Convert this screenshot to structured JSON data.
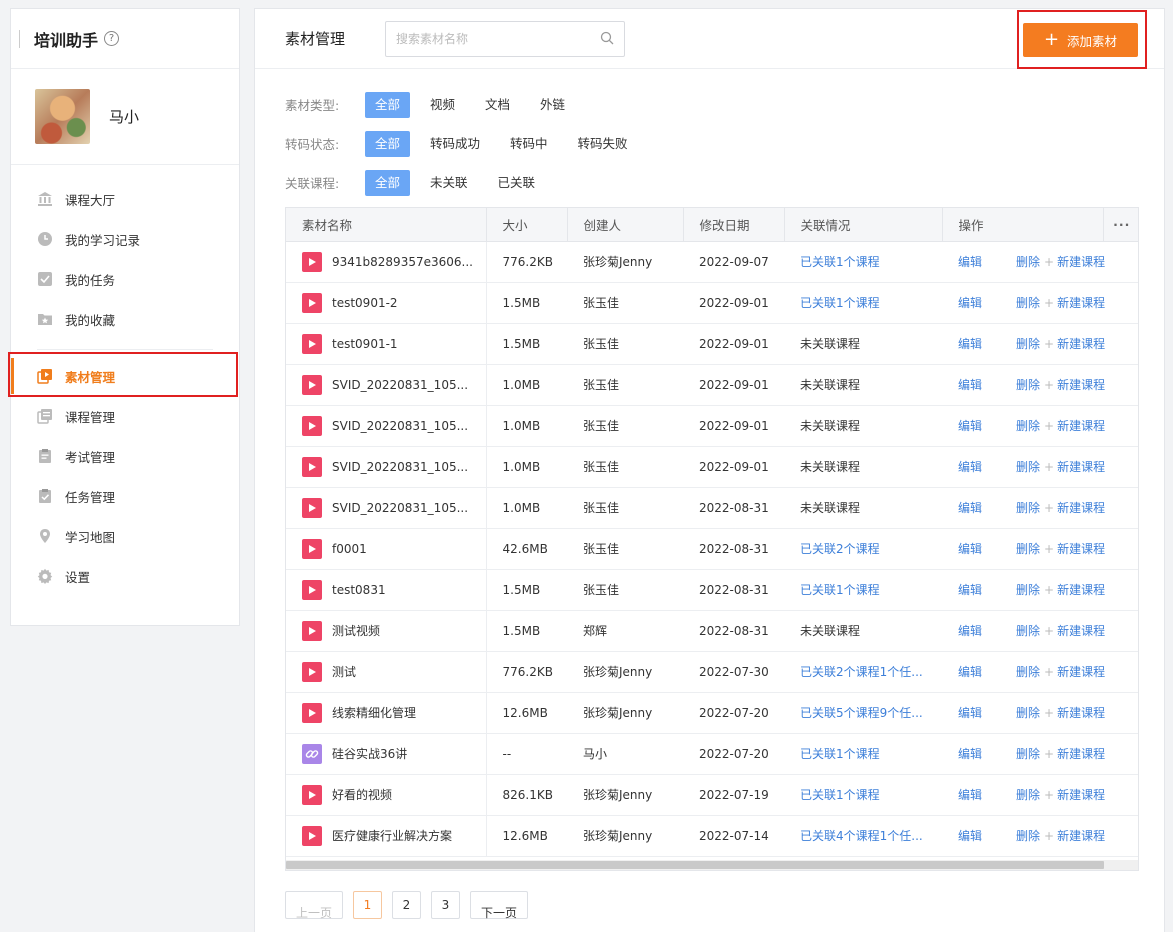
{
  "sidebar": {
    "title": "培训助手",
    "help_icon": "?",
    "user_name": "马小",
    "items": [
      {
        "label": "课程大厅",
        "icon": "bank-icon"
      },
      {
        "label": "我的学习记录",
        "icon": "clock-icon"
      },
      {
        "label": "我的任务",
        "icon": "check-square-icon"
      },
      {
        "label": "我的收藏",
        "icon": "star-folder-icon"
      },
      {
        "label": "素材管理",
        "icon": "media-icon",
        "active": true
      },
      {
        "label": "课程管理",
        "icon": "course-list-icon"
      },
      {
        "label": "考试管理",
        "icon": "exam-clipboard-icon"
      },
      {
        "label": "任务管理",
        "icon": "task-clipboard-icon"
      },
      {
        "label": "学习地图",
        "icon": "map-pin-icon"
      },
      {
        "label": "设置",
        "icon": "gear-icon"
      }
    ]
  },
  "header": {
    "title": "素材管理",
    "search_placeholder": "搜索素材名称",
    "add_button": "添加素材"
  },
  "filters": [
    {
      "label": "素材类型:",
      "options": [
        "全部",
        "视频",
        "文档",
        "外链"
      ],
      "selected": 0
    },
    {
      "label": "转码状态:",
      "options": [
        "全部",
        "转码成功",
        "转码中",
        "转码失败"
      ],
      "selected": 0
    },
    {
      "label": "关联课程:",
      "options": [
        "全部",
        "未关联",
        "已关联"
      ],
      "selected": 0
    }
  ],
  "table": {
    "columns": [
      "素材名称",
      "大小",
      "创建人",
      "修改日期",
      "关联情况",
      "操作",
      "···"
    ],
    "actions": {
      "edit": "编辑",
      "delete": "删除",
      "new_course": "新建课程"
    },
    "rows": [
      {
        "type": "video",
        "name": "9341b8289357e3606...",
        "size": "776.2KB",
        "creator": "张珍菊Jenny",
        "date": "2022-09-07",
        "relation": "已关联1个课程",
        "linked": true
      },
      {
        "type": "video",
        "name": "test0901-2",
        "size": "1.5MB",
        "creator": "张玉佳",
        "date": "2022-09-01",
        "relation": "已关联1个课程",
        "linked": true
      },
      {
        "type": "video",
        "name": "test0901-1",
        "size": "1.5MB",
        "creator": "张玉佳",
        "date": "2022-09-01",
        "relation": "未关联课程",
        "linked": false
      },
      {
        "type": "video",
        "name": "SVID_20220831_105...",
        "size": "1.0MB",
        "creator": "张玉佳",
        "date": "2022-09-01",
        "relation": "未关联课程",
        "linked": false
      },
      {
        "type": "video",
        "name": "SVID_20220831_105...",
        "size": "1.0MB",
        "creator": "张玉佳",
        "date": "2022-09-01",
        "relation": "未关联课程",
        "linked": false
      },
      {
        "type": "video",
        "name": "SVID_20220831_105...",
        "size": "1.0MB",
        "creator": "张玉佳",
        "date": "2022-09-01",
        "relation": "未关联课程",
        "linked": false
      },
      {
        "type": "video",
        "name": "SVID_20220831_105...",
        "size": "1.0MB",
        "creator": "张玉佳",
        "date": "2022-08-31",
        "relation": "未关联课程",
        "linked": false
      },
      {
        "type": "video",
        "name": "f0001",
        "size": "42.6MB",
        "creator": "张玉佳",
        "date": "2022-08-31",
        "relation": "已关联2个课程",
        "linked": true
      },
      {
        "type": "video",
        "name": "test0831",
        "size": "1.5MB",
        "creator": "张玉佳",
        "date": "2022-08-31",
        "relation": "已关联1个课程",
        "linked": true
      },
      {
        "type": "video",
        "name": "测试视频",
        "size": "1.5MB",
        "creator": "郑辉",
        "date": "2022-08-31",
        "relation": "未关联课程",
        "linked": false
      },
      {
        "type": "video",
        "name": "测试",
        "size": "776.2KB",
        "creator": "张珍菊Jenny",
        "date": "2022-07-30",
        "relation": "已关联2个课程1个任...",
        "linked": true
      },
      {
        "type": "video",
        "name": "线索精细化管理",
        "size": "12.6MB",
        "creator": "张珍菊Jenny",
        "date": "2022-07-20",
        "relation": "已关联5个课程9个任...",
        "linked": true
      },
      {
        "type": "link",
        "name": "硅谷实战36讲",
        "size": "--",
        "creator": "马小",
        "date": "2022-07-20",
        "relation": "已关联1个课程",
        "linked": true
      },
      {
        "type": "video",
        "name": "好看的视频",
        "size": "826.1KB",
        "creator": "张珍菊Jenny",
        "date": "2022-07-19",
        "relation": "已关联1个课程",
        "linked": true
      },
      {
        "type": "video",
        "name": "医疗健康行业解决方案",
        "size": "12.6MB",
        "creator": "张珍菊Jenny",
        "date": "2022-07-14",
        "relation": "已关联4个课程1个任...",
        "linked": true
      }
    ]
  },
  "pagination": {
    "prev": "上一页",
    "next": "下一页",
    "pages": [
      "1",
      "2",
      "3"
    ],
    "current": "1"
  },
  "colors": {
    "accent": "#f47c20",
    "chip_selected": "#6aa6f5",
    "link": "#3d7fd9",
    "highlight_box": "#e02020",
    "video_icon": "#ee4466",
    "link_icon": "#a986e8"
  }
}
